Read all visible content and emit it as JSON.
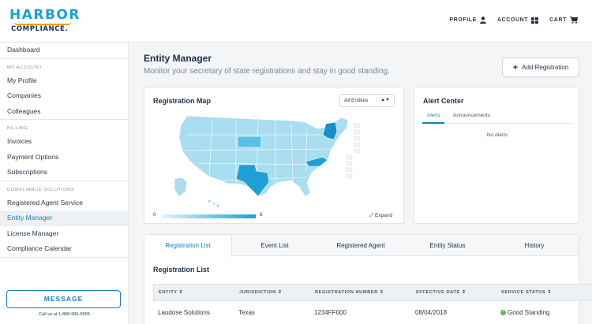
{
  "header": {
    "logo_line1": "HARBOR",
    "logo_line2": "COMPLIANCE.",
    "nav": [
      {
        "label": "PROFILE",
        "icon": "user-icon"
      },
      {
        "label": "ACCOUNT",
        "icon": "grid-icon"
      },
      {
        "label": "CART",
        "icon": "cart-icon"
      }
    ]
  },
  "sidebar": {
    "dashboard": "Dashboard",
    "sections": [
      {
        "title": "MY ACCOUNT",
        "items": [
          "My Profile",
          "Companies",
          "Colleagues"
        ]
      },
      {
        "title": "BILLING",
        "items": [
          "Invoices",
          "Payment Options",
          "Subscriptions"
        ]
      },
      {
        "title": "COMPLIANCE SOLUTIONS",
        "items": [
          "Registered Agent Service",
          "Entity Manager",
          "License Manager",
          "Compliance Calendar"
        ]
      }
    ],
    "active": "Entity Manager",
    "message_button": "MESSAGE",
    "call_text": "Call us at 1-888-995-5895"
  },
  "main": {
    "title": "Entity Manager",
    "subtitle": "Monitor your secretary of state registrations and stay in good standing.",
    "add_button": "Add Registration"
  },
  "map": {
    "title": "Registration Map",
    "filter_value": "All Entities",
    "legend_min": "0",
    "legend_max": "6",
    "expand_label": "Expand",
    "colors": {
      "light": "#a9ddf0",
      "medium": "#5cc0e6",
      "dark": "#1f9fd4",
      "darkest": "#1590c8"
    }
  },
  "alerts": {
    "title": "Alert Center",
    "tabs": [
      "Alerts",
      "Announcements"
    ],
    "empty_text": "No Alerts"
  },
  "tabs": [
    "Registration List",
    "Event List",
    "Registered Agent",
    "Entity Status",
    "History"
  ],
  "list": {
    "title": "Registration List",
    "columns": [
      "ENTITY",
      "JURISDICTION",
      "REGISTRATION NUMBER",
      "EFFECTIVE DATE",
      "SERVICE STATUS"
    ],
    "rows": [
      {
        "entity": "Laudose Solutions",
        "jurisdiction": "Texas",
        "number": "1234FF000",
        "date": "08/04/2018",
        "status": "Good Standing"
      }
    ]
  }
}
